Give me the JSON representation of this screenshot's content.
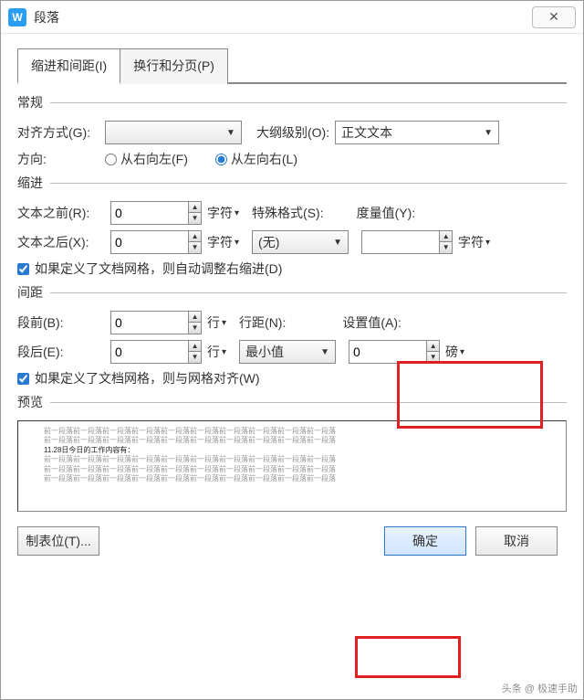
{
  "window": {
    "title": "段落",
    "close": "✕"
  },
  "tabs": {
    "t1": "缩进和间距(I)",
    "t2": "换行和分页(P)"
  },
  "general": {
    "title": "常规",
    "align_label": "对齐方式(G):",
    "align_value": "",
    "outline_label": "大纲级别(O):",
    "outline_value": "正文文本",
    "direction_label": "方向:",
    "rtl": "从右向左(F)",
    "ltr": "从左向右(L)"
  },
  "indent": {
    "title": "缩进",
    "before_label": "文本之前(R):",
    "before_value": "0",
    "before_unit": "字符",
    "after_label": "文本之后(X):",
    "after_value": "0",
    "after_unit": "字符",
    "special_label": "特殊格式(S):",
    "special_value": "(无)",
    "measure_label": "度量值(Y):",
    "measure_value": "",
    "measure_unit": "字符",
    "grid_check": "如果定义了文档网格，则自动调整右缩进(D)"
  },
  "spacing": {
    "title": "间距",
    "before_label": "段前(B):",
    "before_value": "0",
    "before_unit": "行",
    "after_label": "段后(E):",
    "after_value": "0",
    "after_unit": "行",
    "line_label": "行距(N):",
    "line_value": "最小值",
    "set_label": "设置值(A):",
    "set_value": "0",
    "set_unit": "磅",
    "grid_check": "如果定义了文档网格，则与网格对齐(W)"
  },
  "preview": {
    "title": "预览",
    "filler": "前一段落前一段落前一段落前一段落前一段落前一段落前一段落前一段落前一段落前一段落",
    "main": "11.28日今日的工作内容有："
  },
  "footer": {
    "tabs_btn": "制表位(T)...",
    "ok": "确定",
    "cancel": "取消"
  },
  "watermark": "头条 @ 极速手助"
}
